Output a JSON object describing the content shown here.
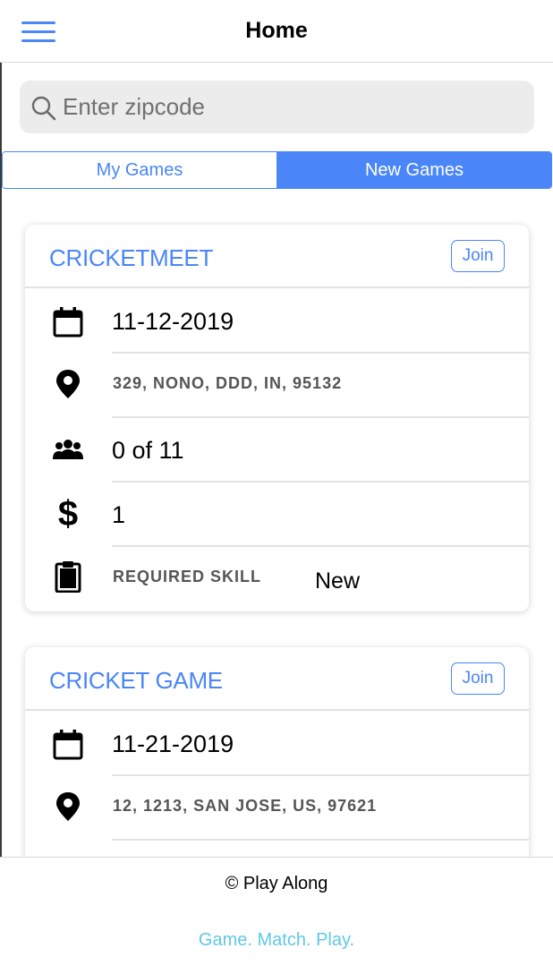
{
  "header": {
    "title": "Home",
    "menu_icon": "hamburger-menu-icon"
  },
  "search": {
    "placeholder": "Enter zipcode",
    "value": "",
    "icon": "search-icon"
  },
  "tabs": [
    {
      "label": "My Games",
      "active": false
    },
    {
      "label": "New Games",
      "active": true
    }
  ],
  "games": [
    {
      "title": "CRICKETMEET",
      "join_label": "Join",
      "date": "11-12-2019",
      "address": "329, NONO, DDD, IN, 95132",
      "players": "0 of 11",
      "fee": "1",
      "skill_label": "REQUIRED SKILL",
      "skill_value": "New"
    },
    {
      "title": "CRICKET GAME",
      "join_label": "Join",
      "date": "11-21-2019",
      "address": "12, 1213, SAN JOSE, US, 97621"
    }
  ],
  "footer": {
    "copyright": "© Play Along",
    "tagline": "Game. Match. Play."
  },
  "colors": {
    "accent": "#4a86f7",
    "tagline": "#5ec8e8"
  }
}
